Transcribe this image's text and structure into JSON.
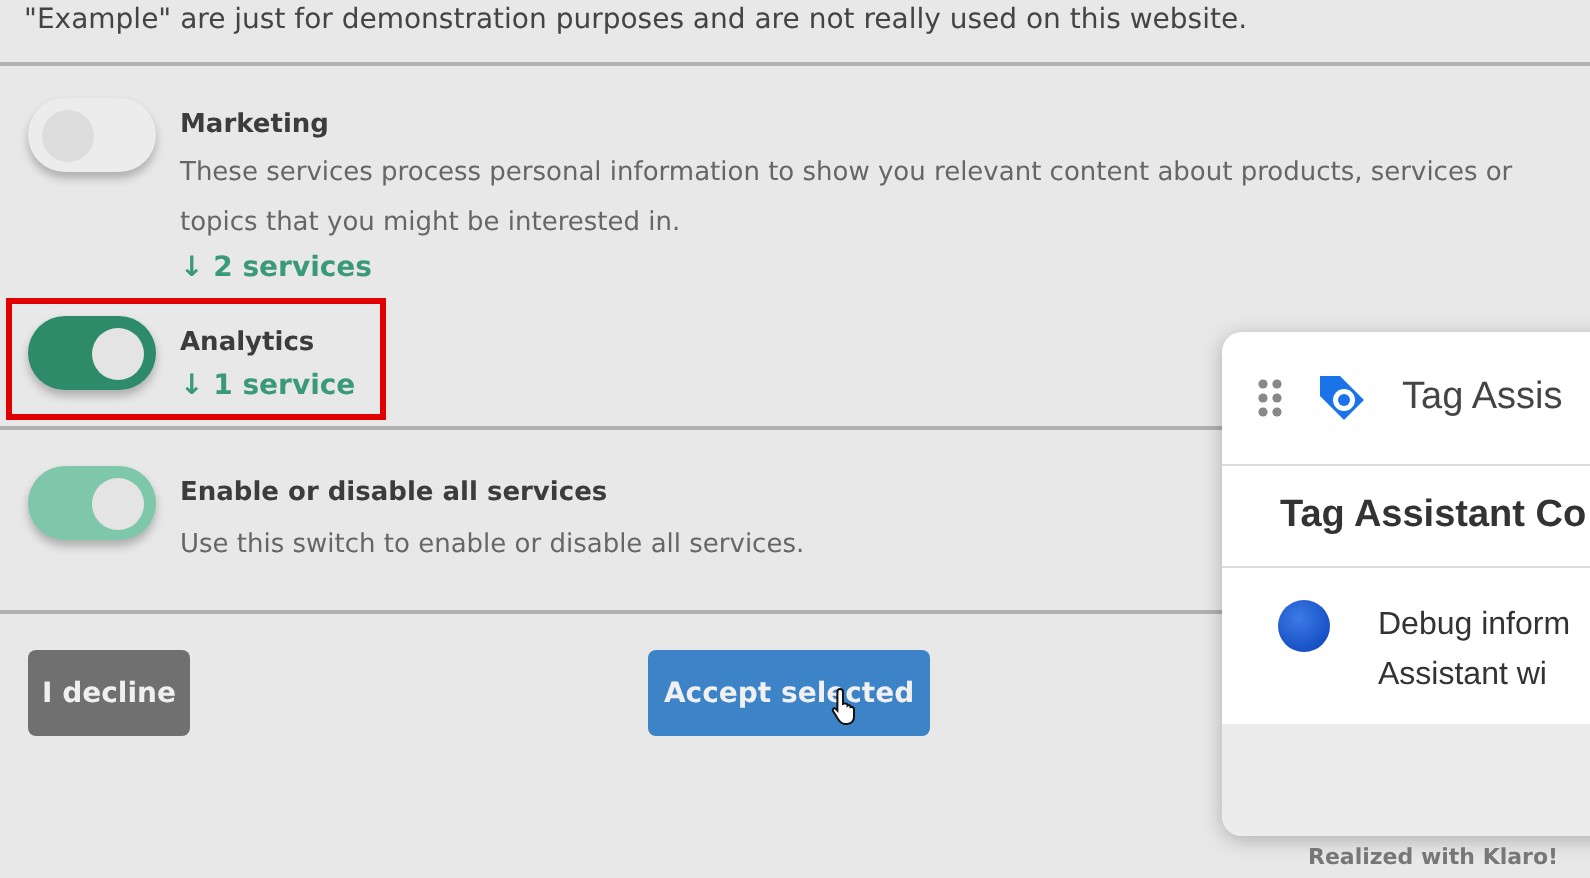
{
  "intro": "\"Example\" are just for demonstration purposes and are not really used on this website.",
  "purposes": [
    {
      "title": "Marketing",
      "on": false,
      "highlighted": false,
      "description": "These services process personal information to show you relevant content about products, services or topics that you might be interested in.",
      "services": "↓ 2 services"
    },
    {
      "title": "Analytics",
      "on": true,
      "highlighted": true,
      "services": "↓ 1 service"
    }
  ],
  "all_toggle": {
    "title": "Enable or disable all services",
    "on": true,
    "partial": true,
    "description": "Use this switch to enable or disable all services."
  },
  "buttons": [
    {
      "label": "I decline",
      "kind": "decline"
    },
    {
      "label": "Accept selected",
      "kind": "accept",
      "hovered": true
    }
  ],
  "footer": "Realized with Klaro!",
  "tag_panel": {
    "title": "Tag Assis",
    "heading": "Tag Assistant Co",
    "message_lines": [
      "Debug inform",
      "Assistant wi"
    ]
  }
}
